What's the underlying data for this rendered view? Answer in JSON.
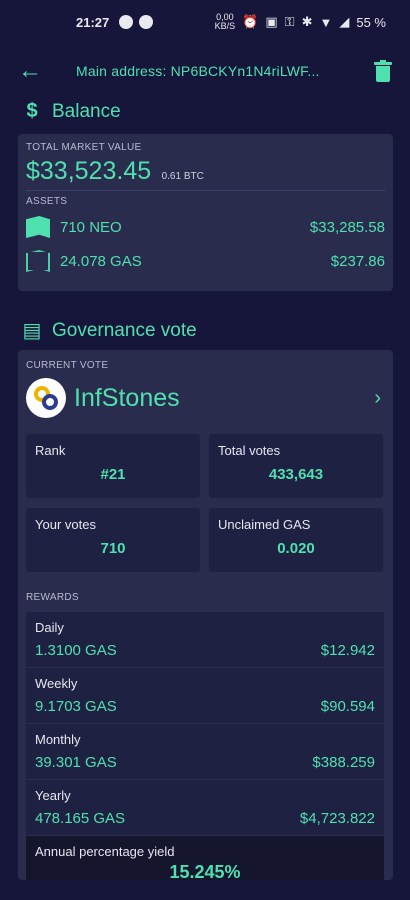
{
  "status_bar": {
    "time": "21:27",
    "data_rate_top": "0,00",
    "data_rate_bottom": "KB/S",
    "battery": "55 %"
  },
  "app_bar": {
    "title": "Main address: NP6BCKYn1N4riLWF..."
  },
  "balance": {
    "heading": "Balance",
    "total_label": "TOTAL MARKET VALUE",
    "total_value": "$33,523.45",
    "total_btc": "0.61 BTC",
    "assets_label": "ASSETS",
    "assets": [
      {
        "amount": "710 NEO",
        "value": "$33,285.58",
        "icon": "neo-icon"
      },
      {
        "amount": "24.078 GAS",
        "value": "$237.86",
        "icon": "gas-icon"
      }
    ]
  },
  "governance": {
    "heading": "Governance vote",
    "current_vote_label": "CURRENT VOTE",
    "candidate_name": "InfStones",
    "stats": [
      {
        "key": "Rank",
        "value": "#21"
      },
      {
        "key": "Total votes",
        "value": "433,643"
      },
      {
        "key": "Your votes",
        "value": "710"
      },
      {
        "key": "Unclaimed GAS",
        "value": "0.020"
      }
    ],
    "rewards_label": "REWARDS",
    "rewards": [
      {
        "period": "Daily",
        "gas": "1.3100 GAS",
        "usd": "$12.942"
      },
      {
        "period": "Weekly",
        "gas": "9.1703 GAS",
        "usd": "$90.594"
      },
      {
        "period": "Monthly",
        "gas": "39.301 GAS",
        "usd": "$388.259"
      },
      {
        "period": "Yearly",
        "gas": "478.165 GAS",
        "usd": "$4,723.822"
      }
    ],
    "apy_label": "Annual percentage yield",
    "apy_value": "15.245%"
  },
  "colors": {
    "accent": "#4fe0b0",
    "background": "#16163a",
    "card": "#2a2c4e",
    "stat_box": "#1f2142"
  }
}
